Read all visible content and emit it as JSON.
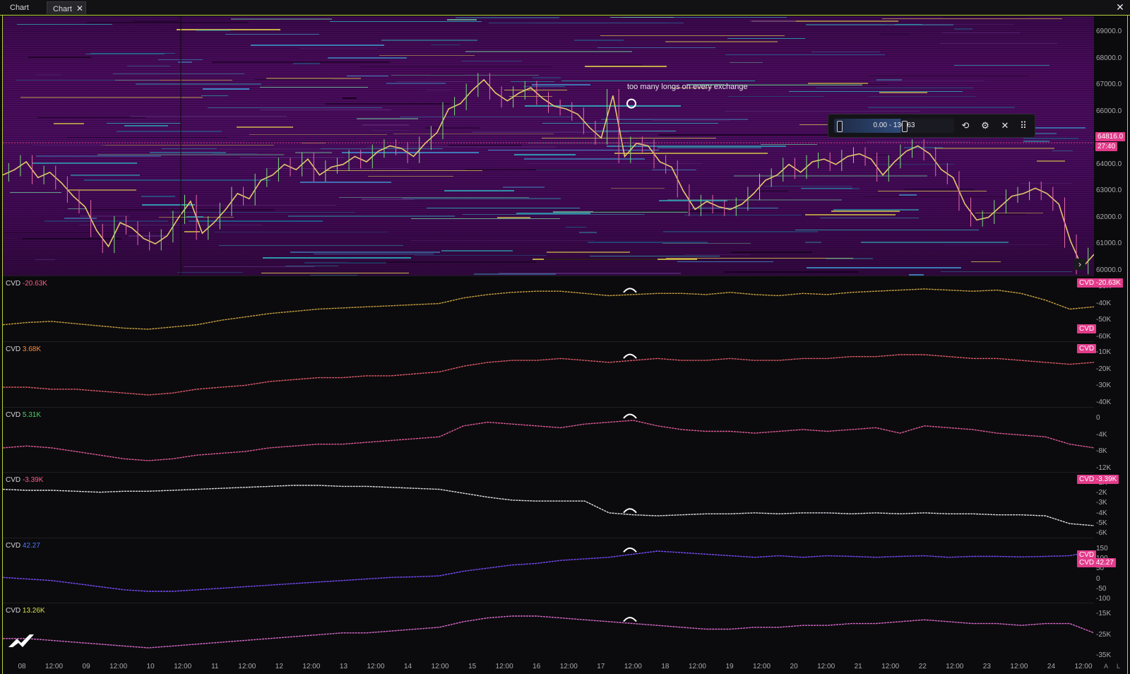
{
  "tabs": [
    {
      "label": "Chart",
      "closable": false
    },
    {
      "label": "Chart",
      "closable": true,
      "active": true
    }
  ],
  "window_close_icon": "close-icon",
  "annotation": "too many longs on every exchange",
  "toolbox": {
    "range_text": "0.00 - 130.63",
    "buttons": [
      "reset-icon",
      "gear-icon",
      "close-icon",
      "drag-handle-icon"
    ]
  },
  "price_axis": {
    "ticks": [
      "69000.0",
      "68000.0",
      "67000.0",
      "66000.0",
      "65000.0",
      "64000.0",
      "63000.0",
      "62000.0",
      "61000.0",
      "60000.0"
    ],
    "current_price": "64816.0",
    "countdown": "27:40",
    "colors": {
      "tag": "#e23b8a"
    }
  },
  "panes": [
    {
      "name": "CVD",
      "value": "-20.63K",
      "value_color": "#ff5c8a",
      "line_color": "#c8a040",
      "ticks": [
        "-30K",
        "-40K",
        "-50K",
        "-60K"
      ],
      "tags": [
        "CVD -20.63K",
        "CVD"
      ],
      "series": [
        -52,
        -50,
        -49,
        -51,
        -53,
        -55,
        -56,
        -54,
        -52,
        -48,
        -45,
        -42,
        -40,
        -38,
        -37,
        -36,
        -35,
        -34,
        -33,
        -28,
        -25,
        -23,
        -22,
        -22,
        -24,
        -26,
        -25,
        -24,
        -24,
        -25,
        -23,
        -25,
        -26,
        -24,
        -25,
        -23,
        -22,
        -21,
        -20,
        -21,
        -22,
        -21,
        -24,
        -30,
        -38,
        -36
      ]
    },
    {
      "name": "CVD",
      "value": "3.68K",
      "value_color": "#ff8a3a",
      "line_color": "#e05a6a",
      "ticks": [
        "-10K",
        "-20K",
        "-30K",
        "-40K"
      ],
      "tags": [
        "CVD"
      ],
      "series": [
        -27,
        -27,
        -28,
        -28,
        -29,
        -30,
        -31,
        -30,
        -28,
        -27,
        -26,
        -24,
        -23,
        -22,
        -22,
        -21,
        -21,
        -20,
        -19,
        -16,
        -14,
        -13,
        -13,
        -12,
        -13,
        -14,
        -13,
        -12,
        -13,
        -13,
        -12,
        -13,
        -13,
        -12,
        -12,
        -11,
        -11,
        -10,
        -10,
        -11,
        -12,
        -12,
        -13,
        -14,
        -15,
        -14
      ]
    },
    {
      "name": "CVD",
      "value": "5.31K",
      "value_color": "#49d36a",
      "line_color": "#e05a9a",
      "ticks": [
        "0",
        "-4K",
        "-8K",
        "-12K"
      ],
      "tags": [],
      "series": [
        -8,
        -7.5,
        -8,
        -9,
        -10,
        -11,
        -11.5,
        -11,
        -10,
        -9.5,
        -9,
        -8,
        -7.5,
        -7,
        -7,
        -6.5,
        -6,
        -5.5,
        -5,
        -2,
        -1,
        -1.5,
        -2,
        -2.5,
        -1.5,
        -1,
        -0.5,
        -2,
        -3,
        -3.5,
        -3.5,
        -4,
        -3.5,
        -3,
        -3.5,
        -3,
        -2.5,
        -4,
        -2,
        -2.5,
        -3,
        -4,
        -4.5,
        -5,
        -7,
        -8
      ]
    },
    {
      "name": "CVD",
      "value": "-3.39K",
      "value_color": "#ff5c8a",
      "line_color": "#e0e0e8",
      "ticks": [
        "-1K",
        "-2K",
        "-3K",
        "-4K",
        "-5K",
        "-6K"
      ],
      "tags": [
        "CVD -3.39K"
      ],
      "series": [
        -1.8,
        -1.9,
        -1.9,
        -2,
        -2.1,
        -2,
        -2,
        -1.9,
        -1.8,
        -1.7,
        -1.6,
        -1.5,
        -1.4,
        -1.4,
        -1.5,
        -1.5,
        -1.6,
        -1.7,
        -1.8,
        -2.2,
        -2.6,
        -2.9,
        -3.0,
        -3.0,
        -3.0,
        -4.2,
        -4.4,
        -4.5,
        -4.4,
        -4.3,
        -4.3,
        -4.2,
        -4.3,
        -4.2,
        -4.2,
        -4.3,
        -4.2,
        -4.3,
        -4.2,
        -4.3,
        -4.3,
        -4.4,
        -4.4,
        -4.5,
        -5.3,
        -5.5
      ]
    },
    {
      "name": "CVD",
      "value": "42.27",
      "value_color": "#4a7bff",
      "line_color": "#7a4cff",
      "ticks": [
        "150",
        "100",
        "50",
        "0",
        "-50",
        "-100"
      ],
      "tags": [
        "CVD",
        "CVD 42.27"
      ],
      "series": [
        -30,
        -35,
        -40,
        -50,
        -60,
        -70,
        -75,
        -75,
        -70,
        -65,
        -60,
        -55,
        -50,
        -45,
        -40,
        -35,
        -30,
        -28,
        -25,
        -10,
        0,
        10,
        15,
        25,
        30,
        35,
        45,
        55,
        50,
        45,
        40,
        35,
        40,
        35,
        40,
        38,
        35,
        38,
        40,
        35,
        38,
        38,
        36,
        38,
        40,
        55
      ]
    },
    {
      "name": "CVD",
      "value": "13.26K",
      "value_color": "#d8e04a",
      "line_color": "#d86acc",
      "ticks": [
        "-15K",
        "-25K",
        "-35K"
      ],
      "tags": [],
      "series": [
        -27,
        -27,
        -28,
        -29,
        -30,
        -31,
        -32,
        -31,
        -30,
        -29,
        -28,
        -27,
        -26,
        -25,
        -24,
        -24,
        -23,
        -22,
        -21,
        -18,
        -16,
        -15,
        -15,
        -16,
        -17,
        -18,
        -19,
        -20,
        -21,
        -22,
        -22,
        -21,
        -21,
        -20,
        -20,
        -19,
        -19,
        -18,
        -17,
        -18,
        -19,
        -19,
        -20,
        -19,
        -19,
        -24
      ]
    }
  ],
  "time_axis": {
    "labels": [
      "08",
      "12:00",
      "09",
      "12:00",
      "10",
      "12:00",
      "11",
      "12:00",
      "12",
      "12:00",
      "13",
      "12:00",
      "14",
      "12:00",
      "15",
      "12:00",
      "16",
      "12:00",
      "17",
      "12:00",
      "18",
      "12:00",
      "19",
      "12:00",
      "20",
      "12:00",
      "21",
      "12:00",
      "22",
      "12:00",
      "23",
      "12:00",
      "24",
      "12:00"
    ],
    "corner": [
      "A",
      "L"
    ]
  },
  "price_series": [
    63600,
    63800,
    64100,
    63500,
    63700,
    63300,
    62800,
    62400,
    61500,
    60900,
    61800,
    61600,
    61200,
    61000,
    61300,
    62000,
    62600,
    61400,
    61800,
    62300,
    62900,
    62700,
    63400,
    63600,
    64000,
    63800,
    64200,
    63600,
    63900,
    64000,
    64300,
    64100,
    64500,
    64700,
    64600,
    64300,
    64800,
    65200,
    66100,
    66300,
    66800,
    67200,
    66700,
    66400,
    66700,
    66900,
    66500,
    66200,
    66100,
    65900,
    65400,
    65000,
    66600,
    64300,
    64800,
    64700,
    64100,
    63900,
    63000,
    62300,
    62600,
    62400,
    62300,
    62500,
    62900,
    63400,
    63600,
    64000,
    63700,
    64100,
    64200,
    64000,
    64300,
    64400,
    64200,
    63600,
    64100,
    64500,
    64700,
    64400,
    63800,
    63500,
    62500,
    61900,
    62000,
    62400,
    62800,
    62900,
    63100,
    62900,
    62500,
    61100,
    60100,
    60600
  ]
}
